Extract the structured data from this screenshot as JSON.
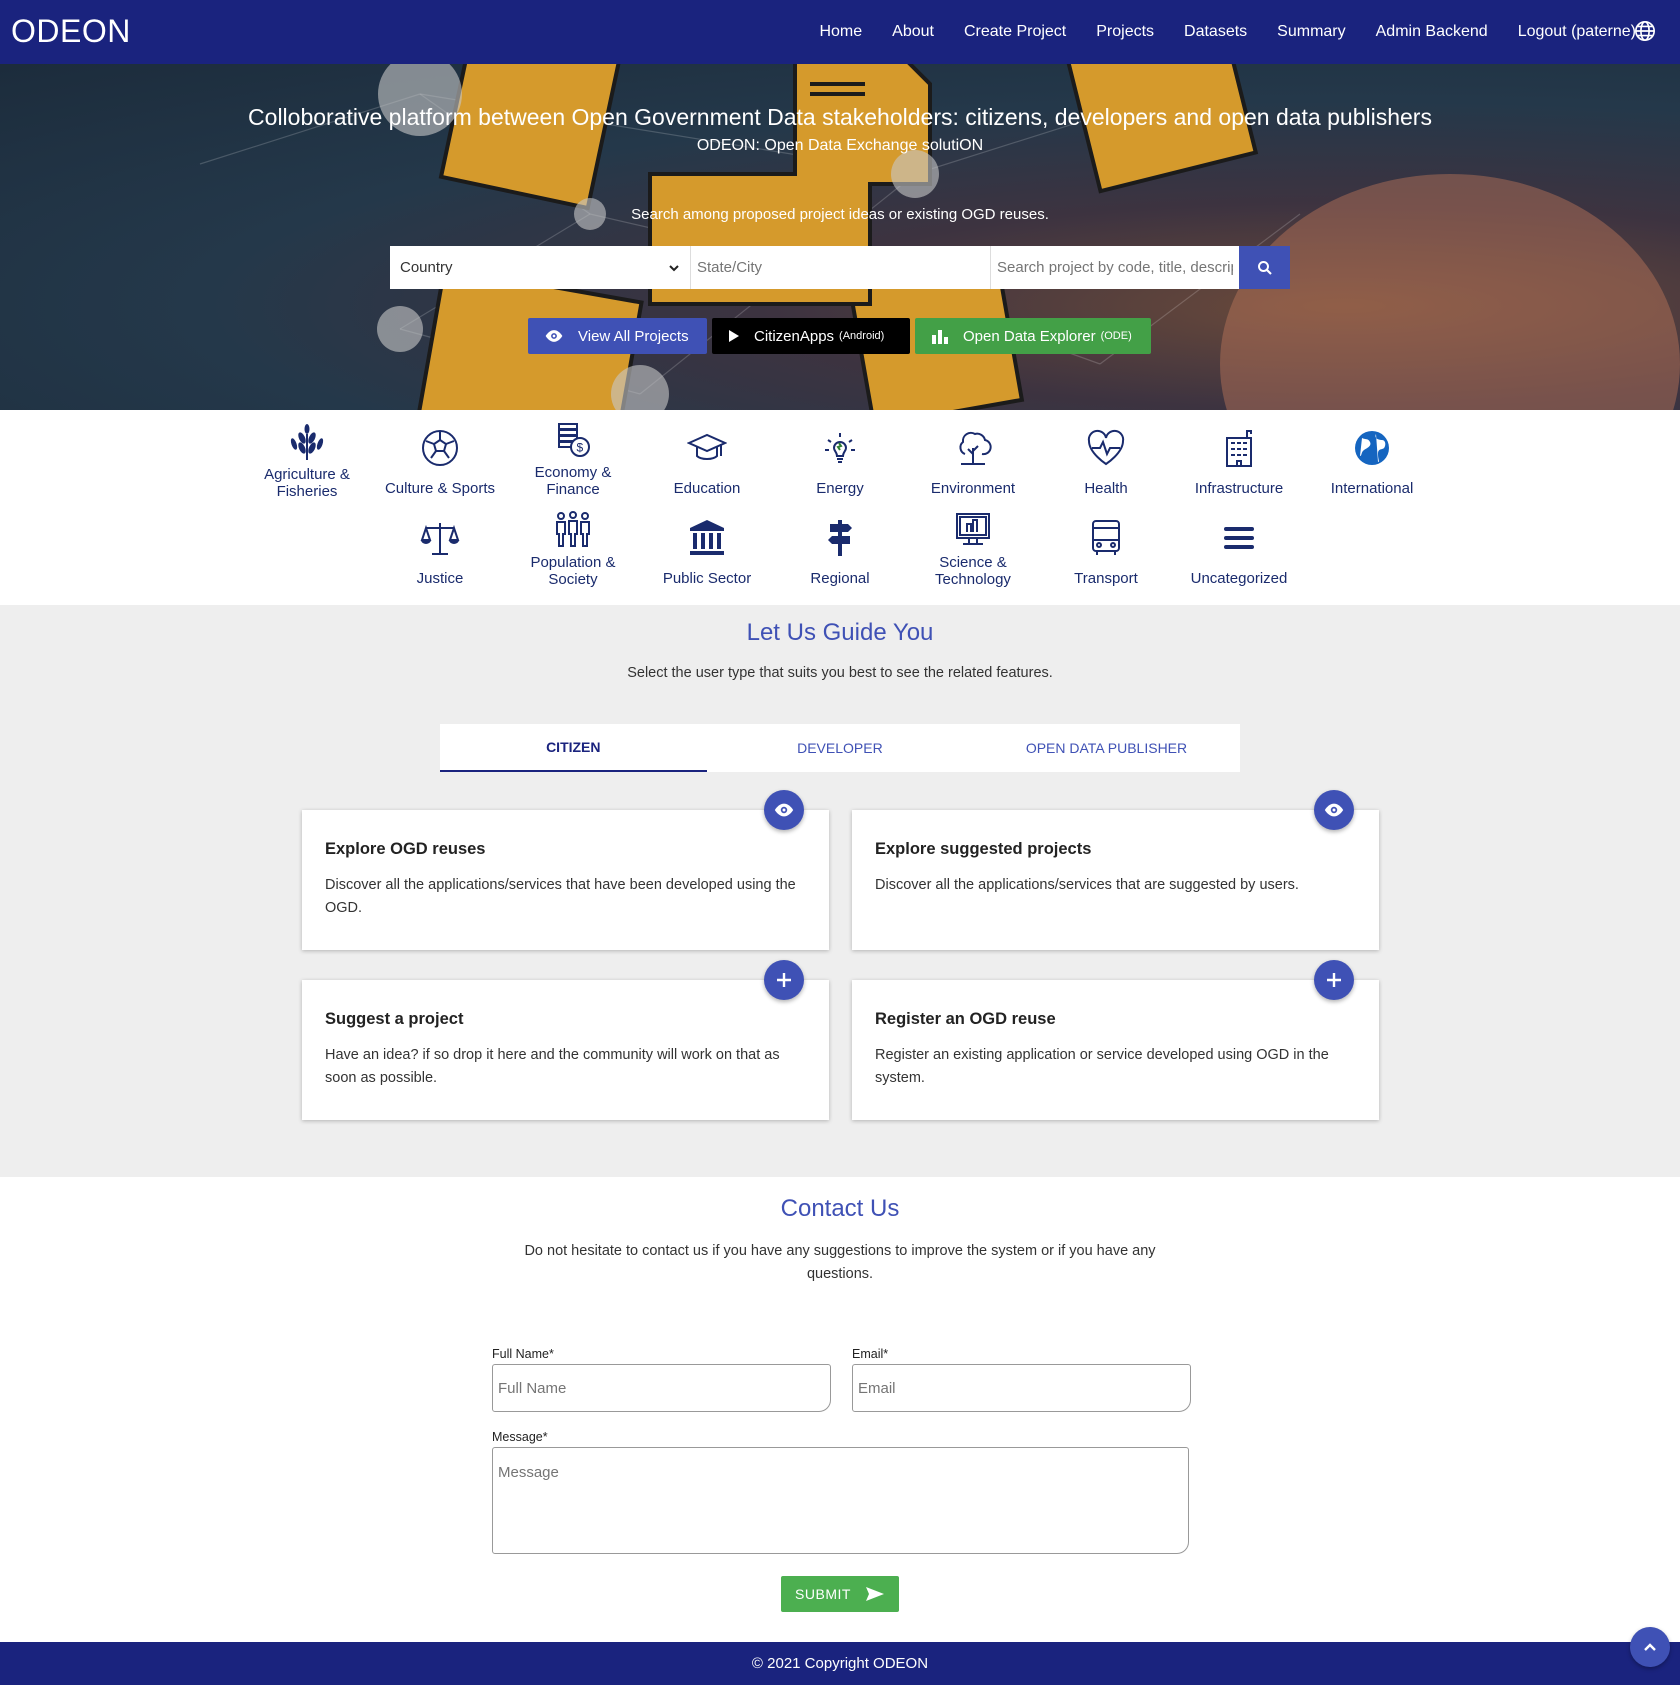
{
  "brand": "ODEON",
  "nav": {
    "items": [
      "Home",
      "About",
      "Create Project",
      "Projects",
      "Datasets",
      "Summary",
      "Admin Backend",
      "Logout (paterne)"
    ],
    "language_icon": "globe-icon"
  },
  "hero": {
    "title": "Colloborative platform between Open Government Data stakeholders: citizens, developers and open data publishers",
    "subtitle": "ODEON: Open Data Exchange solutiON",
    "search_label": "Search among proposed project ideas or existing OGD reuses.",
    "country_select": "Country",
    "state_placeholder": "State/City",
    "search_placeholder": "Search project by code, title, description",
    "buttons": {
      "view_all": "View All Projects",
      "citizen_apps": "CitizenApps",
      "citizen_apps_small": "(Android)",
      "explorer": "Open Data Explorer",
      "explorer_small": "(ODE)"
    }
  },
  "categories": [
    {
      "label": "Agriculture & Fisheries",
      "icon": "wheat-icon"
    },
    {
      "label": "Culture & Sports",
      "icon": "soccer-ball-icon"
    },
    {
      "label": "Economy & Finance",
      "icon": "coins-icon"
    },
    {
      "label": "Education",
      "icon": "graduation-cap-icon"
    },
    {
      "label": "Energy",
      "icon": "lightbulb-icon"
    },
    {
      "label": "Environment",
      "icon": "tree-icon"
    },
    {
      "label": "Health",
      "icon": "heartbeat-icon"
    },
    {
      "label": "Infrastructure",
      "icon": "building-icon"
    },
    {
      "label": "International",
      "icon": "globe-icon"
    },
    {
      "label": "Justice",
      "icon": "scales-icon"
    },
    {
      "label": "Population & Society",
      "icon": "people-icon"
    },
    {
      "label": "Public Sector",
      "icon": "institution-icon"
    },
    {
      "label": "Regional",
      "icon": "signpost-icon"
    },
    {
      "label": "Science & Technology",
      "icon": "computer-icon"
    },
    {
      "label": "Transport",
      "icon": "bus-icon"
    },
    {
      "label": "Uncategorized",
      "icon": "menu-icon"
    }
  ],
  "guide": {
    "title": "Let Us Guide You",
    "subtitle": "Select the user type that suits you best to see the related features.",
    "tabs": [
      "CITIZEN",
      "DEVELOPER",
      "OPEN DATA PUBLISHER"
    ],
    "active_tab": "CITIZEN",
    "cards": [
      {
        "title": "Explore OGD reuses",
        "text": "Discover all the applications/services that have been developed using the OGD.",
        "icon": "eye-icon"
      },
      {
        "title": "Explore suggested projects",
        "text": "Discover all the applications/services that are suggested by users.",
        "icon": "eye-icon"
      },
      {
        "title": "Suggest a project",
        "text": "Have an idea? if so drop it here and the community will work on that as soon as possible.",
        "icon": "plus-icon"
      },
      {
        "title": "Register an OGD reuse",
        "text": "Register an existing application or service developed using OGD in the system.",
        "icon": "plus-icon"
      }
    ]
  },
  "contact": {
    "title": "Contact Us",
    "subtitle": "Do not hesitate to contact us if you have any suggestions to improve the system or if you have any questions.",
    "full_name_label": "Full Name*",
    "full_name_placeholder": "Full Name",
    "email_label": "Email*",
    "email_placeholder": "Email",
    "message_label": "Message*",
    "message_placeholder": "Message",
    "submit": "SUBMIT"
  },
  "footer": "© 2021 Copyright ODEON",
  "colors": {
    "navy": "#1a237e",
    "primary": "#3f51b5",
    "green": "#43a047",
    "guide_bg": "#eeeeee"
  }
}
